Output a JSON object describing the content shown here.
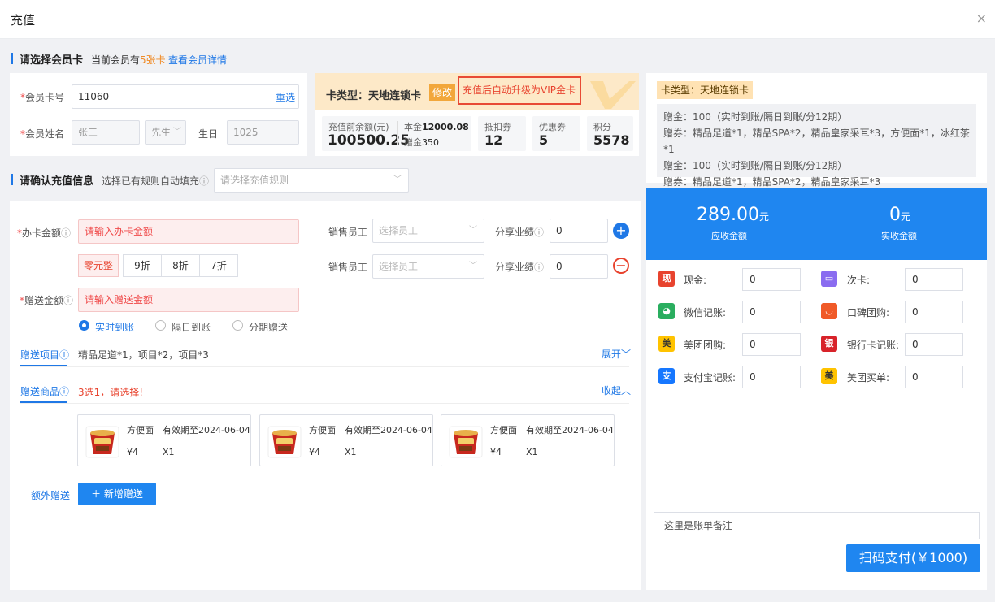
{
  "dialog": {
    "title": "充值",
    "close": "×"
  },
  "member_section": {
    "title": "请选择会员卡",
    "count_prefix": "当前会员有",
    "count_value": "5张卡",
    "view_link": "查看会员详情"
  },
  "member_form": {
    "card_no_label": "会员卡号",
    "card_no_value": "11060",
    "reselect": "重选",
    "name_label": "会员姓名",
    "name_value": "张三",
    "gender_value": "先生",
    "birthday_label": "生日",
    "birthday_value": "1025"
  },
  "card_info": {
    "type_label": "卡类型：天地连锁卡",
    "edit_button": "修改",
    "upgrade_notice": "充值后自动升级为VIP金卡",
    "balance_label": "充值前余额(元)",
    "balance_value": "100500.25",
    "principal_label": "本金",
    "principal_value": "12000.08",
    "gift_label": "赠金",
    "gift_value": "350",
    "stats": [
      {
        "label": "抵扣券",
        "value": "12"
      },
      {
        "label": "优惠券",
        "value": "5"
      },
      {
        "label": "积分",
        "value": "5578"
      }
    ]
  },
  "right_card": {
    "tag": "卡类型：天地连锁卡",
    "lines": [
      "赠金：100（实时到账/隔日到账/分12期）",
      "赠券：精品足道*1，精品SPA*2，精品皇家采耳*3，方便面*1，冰红茶*1",
      "赠金：100（实时到账/隔日到账/分12期）",
      "赠券：精品足道*1，精品SPA*2，精品皇家采耳*3"
    ]
  },
  "recharge_section": {
    "title": "请确认充值信息",
    "rule_label": "选择已有规则自动填充",
    "rule_placeholder": "请选择充值规则"
  },
  "recharge_form": {
    "amount_label": "办卡金额",
    "amount_placeholder": "请输入办卡金额",
    "quick_buttons": [
      "零元整",
      "9折",
      "8折",
      "7折"
    ],
    "gift_amount_label": "赠送金额",
    "gift_amount_placeholder": "请输入赠送金额",
    "arrival_options": [
      "实时到账",
      "隔日到账",
      "分期赠送"
    ],
    "staff_rows": [
      {
        "label": "销售员工",
        "placeholder": "选择员工",
        "share_label": "分享业绩",
        "share_value": "0",
        "action": "+"
      },
      {
        "label": "销售员工",
        "placeholder": "选择员工",
        "share_label": "分享业绩",
        "share_value": "0",
        "action": "−"
      }
    ],
    "gift_items_tab": "赠送项目",
    "gift_items_text": "精品足道*1，项目*2，项目*3",
    "expand": "展开",
    "gift_goods_tab": "赠送商品",
    "gift_goods_hint": "3选1，请选择!",
    "collapse": "收起",
    "goods": [
      {
        "name": "方便面",
        "expiry": "有效期至2024-06-04",
        "price": "¥4",
        "qty": "X1"
      },
      {
        "name": "方便面",
        "expiry": "有效期至2024-06-04",
        "price": "¥4",
        "qty": "X1"
      },
      {
        "name": "方便面",
        "expiry": "有效期至2024-06-04",
        "price": "¥4",
        "qty": "X1"
      }
    ],
    "extra_label": "额外赠送",
    "add_button": "新增赠送"
  },
  "summary": {
    "due_amount": "289.00",
    "due_unit": "元",
    "due_label": "应收金额",
    "paid_amount": "0",
    "paid_unit": "元",
    "paid_label": "实收金额",
    "color": "#1f86f0"
  },
  "payments": [
    {
      "name": "现金:",
      "value": "0",
      "icon": "cash-icon",
      "color": "#e8432e",
      "glyph": "现"
    },
    {
      "name": "次卡:",
      "value": "0",
      "icon": "times-card-icon",
      "color": "#8a6cf0",
      "glyph": "▭"
    },
    {
      "name": "微信记账:",
      "value": "0",
      "icon": "wechat-icon",
      "color": "#2aae5f",
      "glyph": "◕"
    },
    {
      "name": "口碑团购:",
      "value": "0",
      "icon": "koubei-icon",
      "color": "#f05a28",
      "glyph": "◡"
    },
    {
      "name": "美团团购:",
      "value": "0",
      "icon": "meituan-icon",
      "color": "#ffc300",
      "glyph": "美"
    },
    {
      "name": "银行卡记账:",
      "value": "0",
      "icon": "unionpay-icon",
      "color": "#d8232a",
      "glyph": "银"
    },
    {
      "name": "支付宝记账:",
      "value": "0",
      "icon": "alipay-icon",
      "color": "#1677ff",
      "glyph": "支"
    },
    {
      "name": "美团买单:",
      "value": "0",
      "icon": "meituan-pay-icon",
      "color": "#ffc300",
      "glyph": "美"
    }
  ],
  "remark_placeholder": "这里是账单备注",
  "pay_button": "扫码支付(￥1000)"
}
